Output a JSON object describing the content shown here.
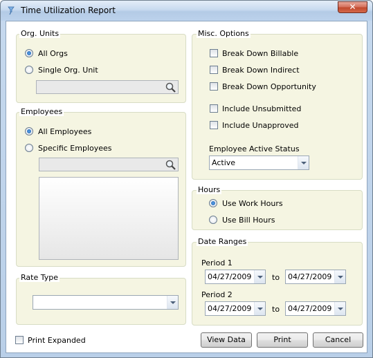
{
  "window": {
    "title": "Time Utilization Report",
    "close_label": "✕"
  },
  "org_units": {
    "legend": "Org. Units",
    "all_orgs": "All Orgs",
    "single_org": "Single Org. Unit",
    "selected": "All Orgs"
  },
  "employees": {
    "legend": "Employees",
    "all": "All Employees",
    "specific": "Specific Employees",
    "selected": "All Employees"
  },
  "rate_type": {
    "legend": "Rate Type",
    "value": ""
  },
  "misc": {
    "legend": "Misc. Options",
    "options": [
      {
        "label": "Break Down Billable",
        "checked": false
      },
      {
        "label": "Break Down Indirect",
        "checked": false
      },
      {
        "label": "Break Down Opportunity",
        "checked": false
      },
      {
        "label": "Include Unsubmitted",
        "checked": false
      },
      {
        "label": "Include Unapproved",
        "checked": false
      }
    ],
    "status_label": "Employee Active Status",
    "status_value": "Active"
  },
  "hours": {
    "legend": "Hours",
    "work": "Use Work Hours",
    "bill": "Use Bill Hours",
    "selected": "Use Work Hours"
  },
  "date_ranges": {
    "legend": "Date Ranges",
    "to_label": "to",
    "period1": {
      "label": "Period 1",
      "from": "04/27/2009",
      "to": "04/27/2009"
    },
    "period2": {
      "label": "Period 2",
      "from": "04/27/2009",
      "to": "04/27/2009"
    }
  },
  "print_expanded": {
    "label": "Print Expanded",
    "checked": false
  },
  "buttons": {
    "view_data": "View Data",
    "print": "Print",
    "cancel": "Cancel"
  }
}
